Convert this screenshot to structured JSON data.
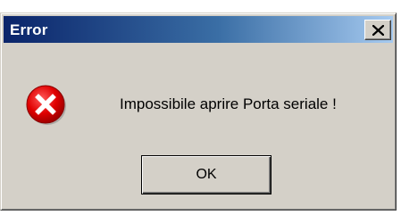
{
  "dialog": {
    "title": "Error",
    "message": "Impossibile aprire Porta seriale !",
    "ok_label": "OK",
    "close_icon": "close-icon",
    "error_icon": "error-icon"
  },
  "colors": {
    "titlebar_start": "#0a246a",
    "titlebar_end": "#a6caf0",
    "dialog_face": "#d4d0c8",
    "error_red": "#e00000"
  }
}
